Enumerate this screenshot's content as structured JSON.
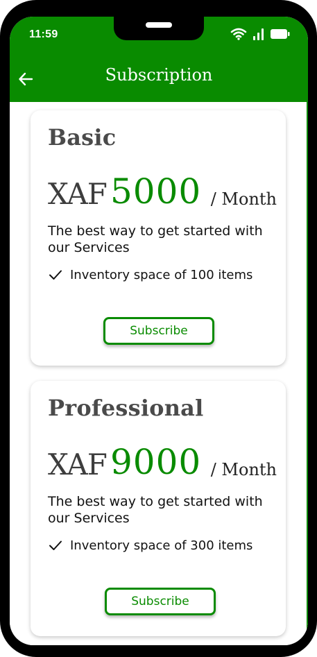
{
  "status_bar": {
    "time": "11:59",
    "icons": [
      "wifi-icon",
      "signal-icon",
      "battery-icon"
    ]
  },
  "app_bar": {
    "title": "Subscription",
    "back_icon": "back-arrow-icon"
  },
  "colors": {
    "brand_green": "#098b00",
    "text_dark": "#3d3d3d",
    "device_frame": "#000000"
  },
  "plans": [
    {
      "name": "Basic",
      "currency": "XAF",
      "amount": "5000",
      "period": "/ Month",
      "description": "The best way to get started with our Services",
      "feature": "Inventory space of 100 items",
      "button_label": "Subscribe"
    },
    {
      "name": "Professional",
      "currency": "XAF",
      "amount": "9000",
      "period": "/ Month",
      "description": "The best way to get started with our Services",
      "feature": "Inventory space of 300 items",
      "button_label": "Subscribe"
    }
  ]
}
